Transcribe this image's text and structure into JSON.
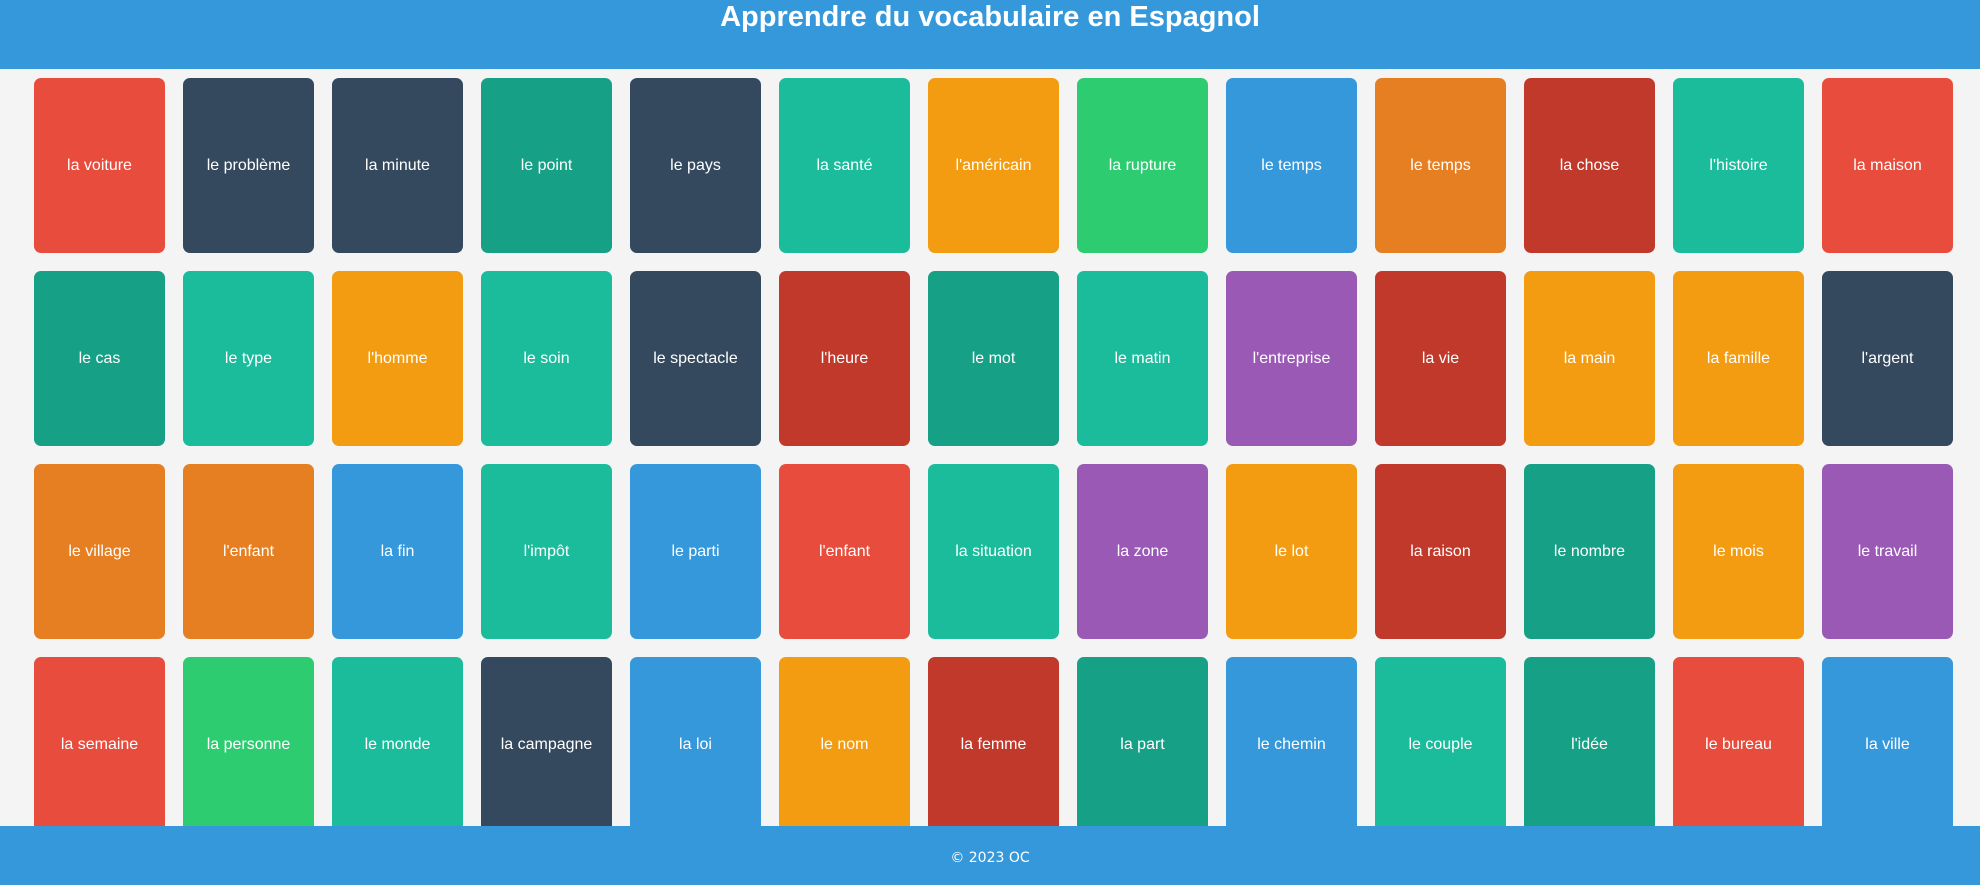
{
  "header": {
    "title": "Apprendre du vocabulaire en Espagnol"
  },
  "colors": {
    "header_bg": "#3498db",
    "page_bg": "#f4f4f4"
  },
  "cards": [
    {
      "label": "la voiture",
      "color": "#e74c3c"
    },
    {
      "label": "le problème",
      "color": "#34495e"
    },
    {
      "label": "la minute",
      "color": "#34495e"
    },
    {
      "label": "le point",
      "color": "#16a085"
    },
    {
      "label": "le pays",
      "color": "#34495e"
    },
    {
      "label": "la santé",
      "color": "#1abc9c"
    },
    {
      "label": "l'américain",
      "color": "#f39c12"
    },
    {
      "label": "la rupture",
      "color": "#2ecc71"
    },
    {
      "label": "le temps",
      "color": "#3498db"
    },
    {
      "label": "le temps",
      "color": "#e67e22"
    },
    {
      "label": "la chose",
      "color": "#c0392b"
    },
    {
      "label": "l'histoire",
      "color": "#1abc9c"
    },
    {
      "label": "la maison",
      "color": "#e74c3c"
    },
    {
      "label": "le cas",
      "color": "#16a085"
    },
    {
      "label": "le type",
      "color": "#1abc9c"
    },
    {
      "label": "l'homme",
      "color": "#f39c12"
    },
    {
      "label": "le soin",
      "color": "#1abc9c"
    },
    {
      "label": "le spectacle",
      "color": "#34495e"
    },
    {
      "label": "l'heure",
      "color": "#c0392b"
    },
    {
      "label": "le mot",
      "color": "#16a085"
    },
    {
      "label": "le matin",
      "color": "#1abc9c"
    },
    {
      "label": "l'entreprise",
      "color": "#9b59b6"
    },
    {
      "label": "la vie",
      "color": "#c0392b"
    },
    {
      "label": "la main",
      "color": "#f39c12"
    },
    {
      "label": "la famille",
      "color": "#f39c12"
    },
    {
      "label": "l'argent",
      "color": "#34495e"
    },
    {
      "label": "le village",
      "color": "#e67e22"
    },
    {
      "label": "l'enfant",
      "color": "#e67e22"
    },
    {
      "label": "la fin",
      "color": "#3498db"
    },
    {
      "label": "l'impôt",
      "color": "#1abc9c"
    },
    {
      "label": "le parti",
      "color": "#3498db"
    },
    {
      "label": "l'enfant",
      "color": "#e74c3c"
    },
    {
      "label": "la situation",
      "color": "#1abc9c"
    },
    {
      "label": "la zone",
      "color": "#9b59b6"
    },
    {
      "label": "le lot",
      "color": "#f39c12"
    },
    {
      "label": "la raison",
      "color": "#c0392b"
    },
    {
      "label": "le nombre",
      "color": "#16a085"
    },
    {
      "label": "le mois",
      "color": "#f39c12"
    },
    {
      "label": "le travail",
      "color": "#9b59b6"
    },
    {
      "label": "la semaine",
      "color": "#e74c3c"
    },
    {
      "label": "la personne",
      "color": "#2ecc71"
    },
    {
      "label": "le monde",
      "color": "#1abc9c"
    },
    {
      "label": "la campagne",
      "color": "#34495e"
    },
    {
      "label": "la loi",
      "color": "#3498db"
    },
    {
      "label": "le nom",
      "color": "#f39c12"
    },
    {
      "label": "la femme",
      "color": "#c0392b"
    },
    {
      "label": "la part",
      "color": "#16a085"
    },
    {
      "label": "le chemin",
      "color": "#3498db"
    },
    {
      "label": "le couple",
      "color": "#1abc9c"
    },
    {
      "label": "l'idée",
      "color": "#16a085"
    },
    {
      "label": "le bureau",
      "color": "#e74c3c"
    },
    {
      "label": "la ville",
      "color": "#3498db"
    }
  ],
  "footer": {
    "text": "© 2023 OC"
  }
}
